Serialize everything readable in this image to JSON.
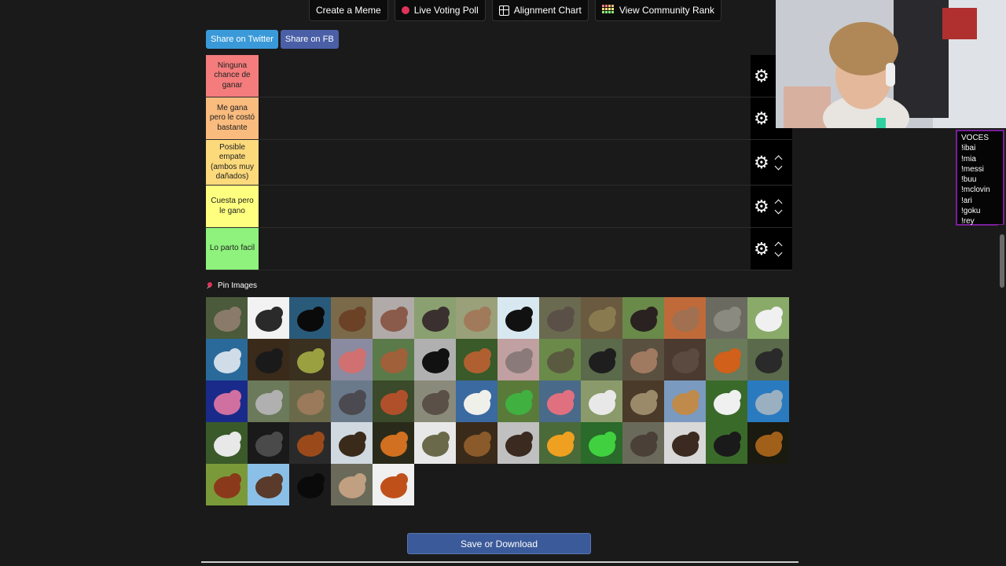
{
  "toolbar": {
    "create_meme": "Create a Meme",
    "live_voting": "Live Voting Poll",
    "alignment_chart": "Alignment Chart",
    "community_rank": "View Community Rank"
  },
  "share": {
    "twitter": "Share on Twitter",
    "fb": "Share on FB",
    "twitter_color": "#3a9ad9",
    "fb_color": "#4a5fa6"
  },
  "tiers": [
    {
      "label": "Ninguna chance de ganar",
      "color": "#f47c7c"
    },
    {
      "label": "Me gana pero le costó bastante",
      "color": "#f9bb7e"
    },
    {
      "label": "Posible empate (ambos muy dañados)",
      "color": "#fcd97b"
    },
    {
      "label": "Cuesta pero le gano",
      "color": "#ffff7f"
    },
    {
      "label": "Lo parto facil",
      "color": "#8ef27c"
    }
  ],
  "pin_images": "Pin Images",
  "image_tiles": [
    {
      "name": "sloth",
      "bg": "#4a5a3a",
      "fg": "#8a7a6a"
    },
    {
      "name": "scorpion",
      "bg": "#f2f2f2",
      "fg": "#2a2a2a"
    },
    {
      "name": "killer-whale",
      "bg": "#2a5a7a",
      "fg": "#0a0a0a"
    },
    {
      "name": "grizzly-bear",
      "bg": "#7a6a4a",
      "fg": "#6b4226"
    },
    {
      "name": "walrus",
      "bg": "#b0aaa8",
      "fg": "#8a5a4a"
    },
    {
      "name": "ostrich",
      "bg": "#8aa070",
      "fg": "#3a3030"
    },
    {
      "name": "kangaroo",
      "bg": "#9aa07a",
      "fg": "#a07a5a"
    },
    {
      "name": "penguin",
      "bg": "#d8e8f0",
      "fg": "#111111"
    },
    {
      "name": "elephant",
      "bg": "#6a6a50",
      "fg": "#5a5048"
    },
    {
      "name": "anaconda",
      "bg": "#6a5a40",
      "fg": "#8a7a50"
    },
    {
      "name": "buffalo",
      "bg": "#6a8a4a",
      "fg": "#2a2220"
    },
    {
      "name": "meerkat",
      "bg": "#c06a3a",
      "fg": "#a07050"
    },
    {
      "name": "rhinoceros",
      "bg": "#6a6a60",
      "fg": "#8a8a80"
    },
    {
      "name": "cow",
      "bg": "#8aaa6a",
      "fg": "#f0f0f0"
    },
    {
      "name": "shark",
      "bg": "#2a6a9a",
      "fg": "#d0dde8"
    },
    {
      "name": "black-snake",
      "bg": "#3a2a1a",
      "fg": "#1a1a1a"
    },
    {
      "name": "chameleon",
      "bg": "#3a3020",
      "fg": "#9aa040"
    },
    {
      "name": "flamingo-lake",
      "bg": "#8a8aa0",
      "fg": "#d07070"
    },
    {
      "name": "deer",
      "bg": "#5a7a4a",
      "fg": "#a0603a"
    },
    {
      "name": "crow",
      "bg": "#b0b0b0",
      "fg": "#111111"
    },
    {
      "name": "squirrel",
      "bg": "#3a5a2a",
      "fg": "#b06030"
    },
    {
      "name": "armadillo",
      "bg": "#c0a0a0",
      "fg": "#8a7a7a"
    },
    {
      "name": "tortoise",
      "bg": "#6a8a4a",
      "fg": "#5a5a40"
    },
    {
      "name": "gorilla",
      "bg": "#5a6a4a",
      "fg": "#1e1e1e"
    },
    {
      "name": "pitbull",
      "bg": "#5a5040",
      "fg": "#a07a60"
    },
    {
      "name": "wild-boar",
      "bg": "#4a3a30",
      "fg": "#5a4a40"
    },
    {
      "name": "fox",
      "bg": "#6a7a5a",
      "fg": "#d0601a"
    },
    {
      "name": "anteater",
      "bg": "#5a6a4a",
      "fg": "#2a2a2a"
    },
    {
      "name": "octopus",
      "bg": "#1a2a8a",
      "fg": "#d070a0"
    },
    {
      "name": "koala",
      "bg": "#6a7a5a",
      "fg": "#b0b0b0"
    },
    {
      "name": "lynx",
      "bg": "#6a6a4a",
      "fg": "#9a7a5a"
    },
    {
      "name": "hippo",
      "bg": "#6a7a8a",
      "fg": "#4a4a50"
    },
    {
      "name": "orangutan",
      "bg": "#3a4a2a",
      "fg": "#b0502a"
    },
    {
      "name": "seal",
      "bg": "#8a8a7a",
      "fg": "#5a5048"
    },
    {
      "name": "polar-bear",
      "bg": "#3a6aa0",
      "fg": "#f0f0ea"
    },
    {
      "name": "parrot",
      "bg": "#5a7a3a",
      "fg": "#40b040"
    },
    {
      "name": "flamingo",
      "bg": "#4a6a8a",
      "fg": "#e07080"
    },
    {
      "name": "zebra",
      "bg": "#8a9a6a",
      "fg": "#e8e8e8"
    },
    {
      "name": "owl",
      "bg": "#4a3a2a",
      "fg": "#9a8a6a"
    },
    {
      "name": "giraffe",
      "bg": "#7a9ac0",
      "fg": "#c08a4a"
    },
    {
      "name": "panda",
      "bg": "#3a6a2a",
      "fg": "#f0f0f0"
    },
    {
      "name": "dolphin",
      "bg": "#2a7ac0",
      "fg": "#9ab0c0"
    },
    {
      "name": "rabbit",
      "bg": "#3a5a2a",
      "fg": "#e8e8e8"
    },
    {
      "name": "wolf",
      "bg": "#1a1a1a",
      "fg": "#4a4a4a"
    },
    {
      "name": "horse",
      "bg": "#2a2a2a",
      "fg": "#9a4a1a"
    },
    {
      "name": "eagle",
      "bg": "#d0d8e0",
      "fg": "#3a2a1a"
    },
    {
      "name": "tiger",
      "bg": "#2a2a1a",
      "fg": "#d07020"
    },
    {
      "name": "crocodile",
      "bg": "#e8e8e8",
      "fg": "#6a6a4a"
    },
    {
      "name": "lion-cub",
      "bg": "#3a2a1a",
      "fg": "#8a5a2a"
    },
    {
      "name": "porcupine",
      "bg": "#c0c0c0",
      "fg": "#3a2a20"
    },
    {
      "name": "toucan",
      "bg": "#4a6a3a",
      "fg": "#f0a020"
    },
    {
      "name": "frog",
      "bg": "#2a6a2a",
      "fg": "#40d040"
    },
    {
      "name": "wombat",
      "bg": "#6a6a5a",
      "fg": "#4a4038"
    },
    {
      "name": "tarantula",
      "bg": "#d8d8d8",
      "fg": "#3a2a20"
    },
    {
      "name": "magpie",
      "bg": "#3a6a2a",
      "fg": "#1a1a1a"
    },
    {
      "name": "lion",
      "bg": "#1a1a10",
      "fg": "#a0601a"
    },
    {
      "name": "bull",
      "bg": "#7a9a3a",
      "fg": "#8a3a1a"
    },
    {
      "name": "bat",
      "bg": "#8ac0e8",
      "fg": "#5a3a2a"
    },
    {
      "name": "black-panther",
      "bg": "#1a1a1a",
      "fg": "#0a0a0a"
    },
    {
      "name": "cougar",
      "bg": "#6a6a5a",
      "fg": "#c0a080"
    },
    {
      "name": "orangutan-2",
      "bg": "#f0f0f0",
      "fg": "#c0501a"
    }
  ],
  "save_button": "Save or Download",
  "voces": {
    "title": "VOCES",
    "items": [
      "!ibai",
      "!mia",
      "!messi",
      "!buu",
      "!mclovin",
      "!ari",
      "!goku",
      "!rey"
    ]
  }
}
